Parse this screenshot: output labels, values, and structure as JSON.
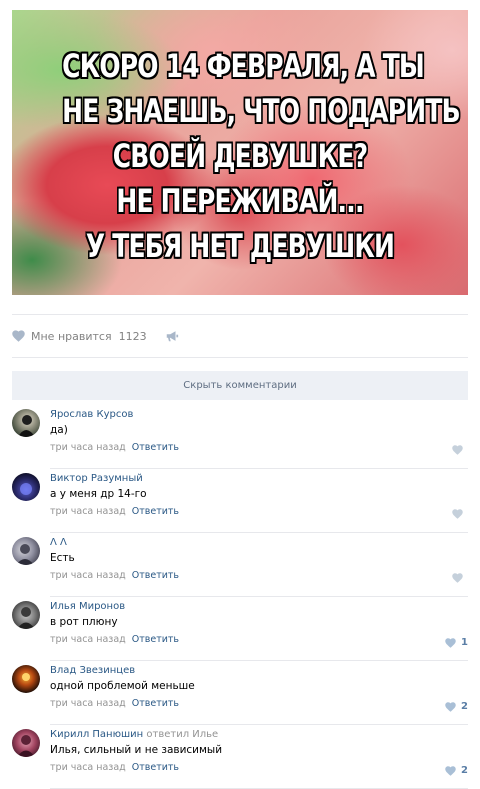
{
  "meme": {
    "lines": [
      "СКОРО 14 ФЕВРАЛЯ, А ТЫ",
      "НЕ ЗНАЕШЬ, ЧТО ПОДАРИТЬ",
      "СВОЕЙ ДЕВУШКЕ?",
      "НЕ ПЕРЕЖИВАЙ...",
      "У ТЕБЯ НЕТ ДЕВУШКИ"
    ]
  },
  "likes": {
    "label": "Мне нравится",
    "count": "1123",
    "icon": "heart-icon",
    "share_icon": "megaphone-icon"
  },
  "hide_comments_label": "Скрыть комментарии",
  "colors": {
    "link": "#2a5885",
    "meta": "#939393",
    "bar_bg": "#edf0f5"
  },
  "comments": [
    {
      "author": "Ярослав Курсов",
      "replied_to": "",
      "text": "да)",
      "time": "три часа назад",
      "reply_label": "Ответить",
      "likes": ""
    },
    {
      "author": "Виктор Разумный",
      "replied_to": "",
      "text": "а у меня др 14-го",
      "time": "три часа назад",
      "reply_label": "Ответить",
      "likes": ""
    },
    {
      "author": "Λ Λ",
      "replied_to": "",
      "text": "Есть",
      "time": "три часа назад",
      "reply_label": "Ответить",
      "likes": ""
    },
    {
      "author": "Илья Миронов",
      "replied_to": "",
      "text": "в рот плюну",
      "time": "три часа назад",
      "reply_label": "Ответить",
      "likes": "1"
    },
    {
      "author": "Влад Звезинцев",
      "replied_to": "",
      "text": "одной проблемой меньше",
      "time": "три часа назад",
      "reply_label": "Ответить",
      "likes": "2"
    },
    {
      "author": "Кирилл Панюшин",
      "replied_to": "ответил Илье",
      "text": "Илья, сильный и не зависимый",
      "time": "три часа назад",
      "reply_label": "Ответить",
      "likes": "2"
    }
  ]
}
